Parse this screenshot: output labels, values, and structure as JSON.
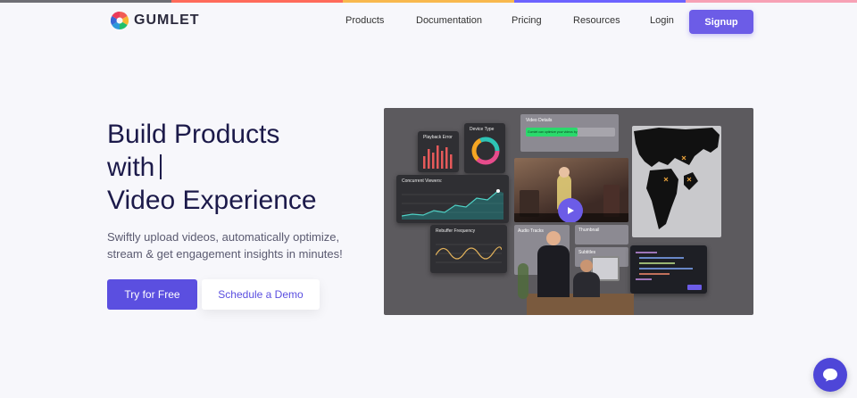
{
  "brand": {
    "name": "GUMLET"
  },
  "nav": {
    "items": [
      "Products",
      "Documentation",
      "Pricing",
      "Resources",
      "Login"
    ],
    "signup_label": "Signup"
  },
  "hero": {
    "title_line1": "Build Products",
    "title_line2": "with",
    "title_line3": "Video Experience",
    "subtitle": "Swiftly upload videos, automatically optimize, stream & get engagement insights in minutes!",
    "primary_cta": "Try for Free",
    "secondary_cta": "Schedule a Demo"
  },
  "showcase": {
    "playback_error": "Playback Error",
    "device_type": "Device Type",
    "concurrent_viewers": "Concurrent Viewers:",
    "rebuffer_frequency": "Rebuffer Frequency",
    "video_details": "Video Details",
    "video_details_notice": "Gumlet can optimize your videos by 80%",
    "audio_tracks": "Audio Tracks",
    "thumbnail": "Thumbnail",
    "subtitles": "Subtitles"
  },
  "colors": {
    "accent": "#5b4fe0",
    "signup": "#6c5ce7",
    "topline": [
      "#ff7a59",
      "#f36f8a",
      "#f8b84e",
      "#6c63ff",
      "#f7a1b5"
    ]
  },
  "icons": {
    "play": "play-icon",
    "chat": "chat-icon",
    "logo": "gumlet-logo-icon"
  }
}
